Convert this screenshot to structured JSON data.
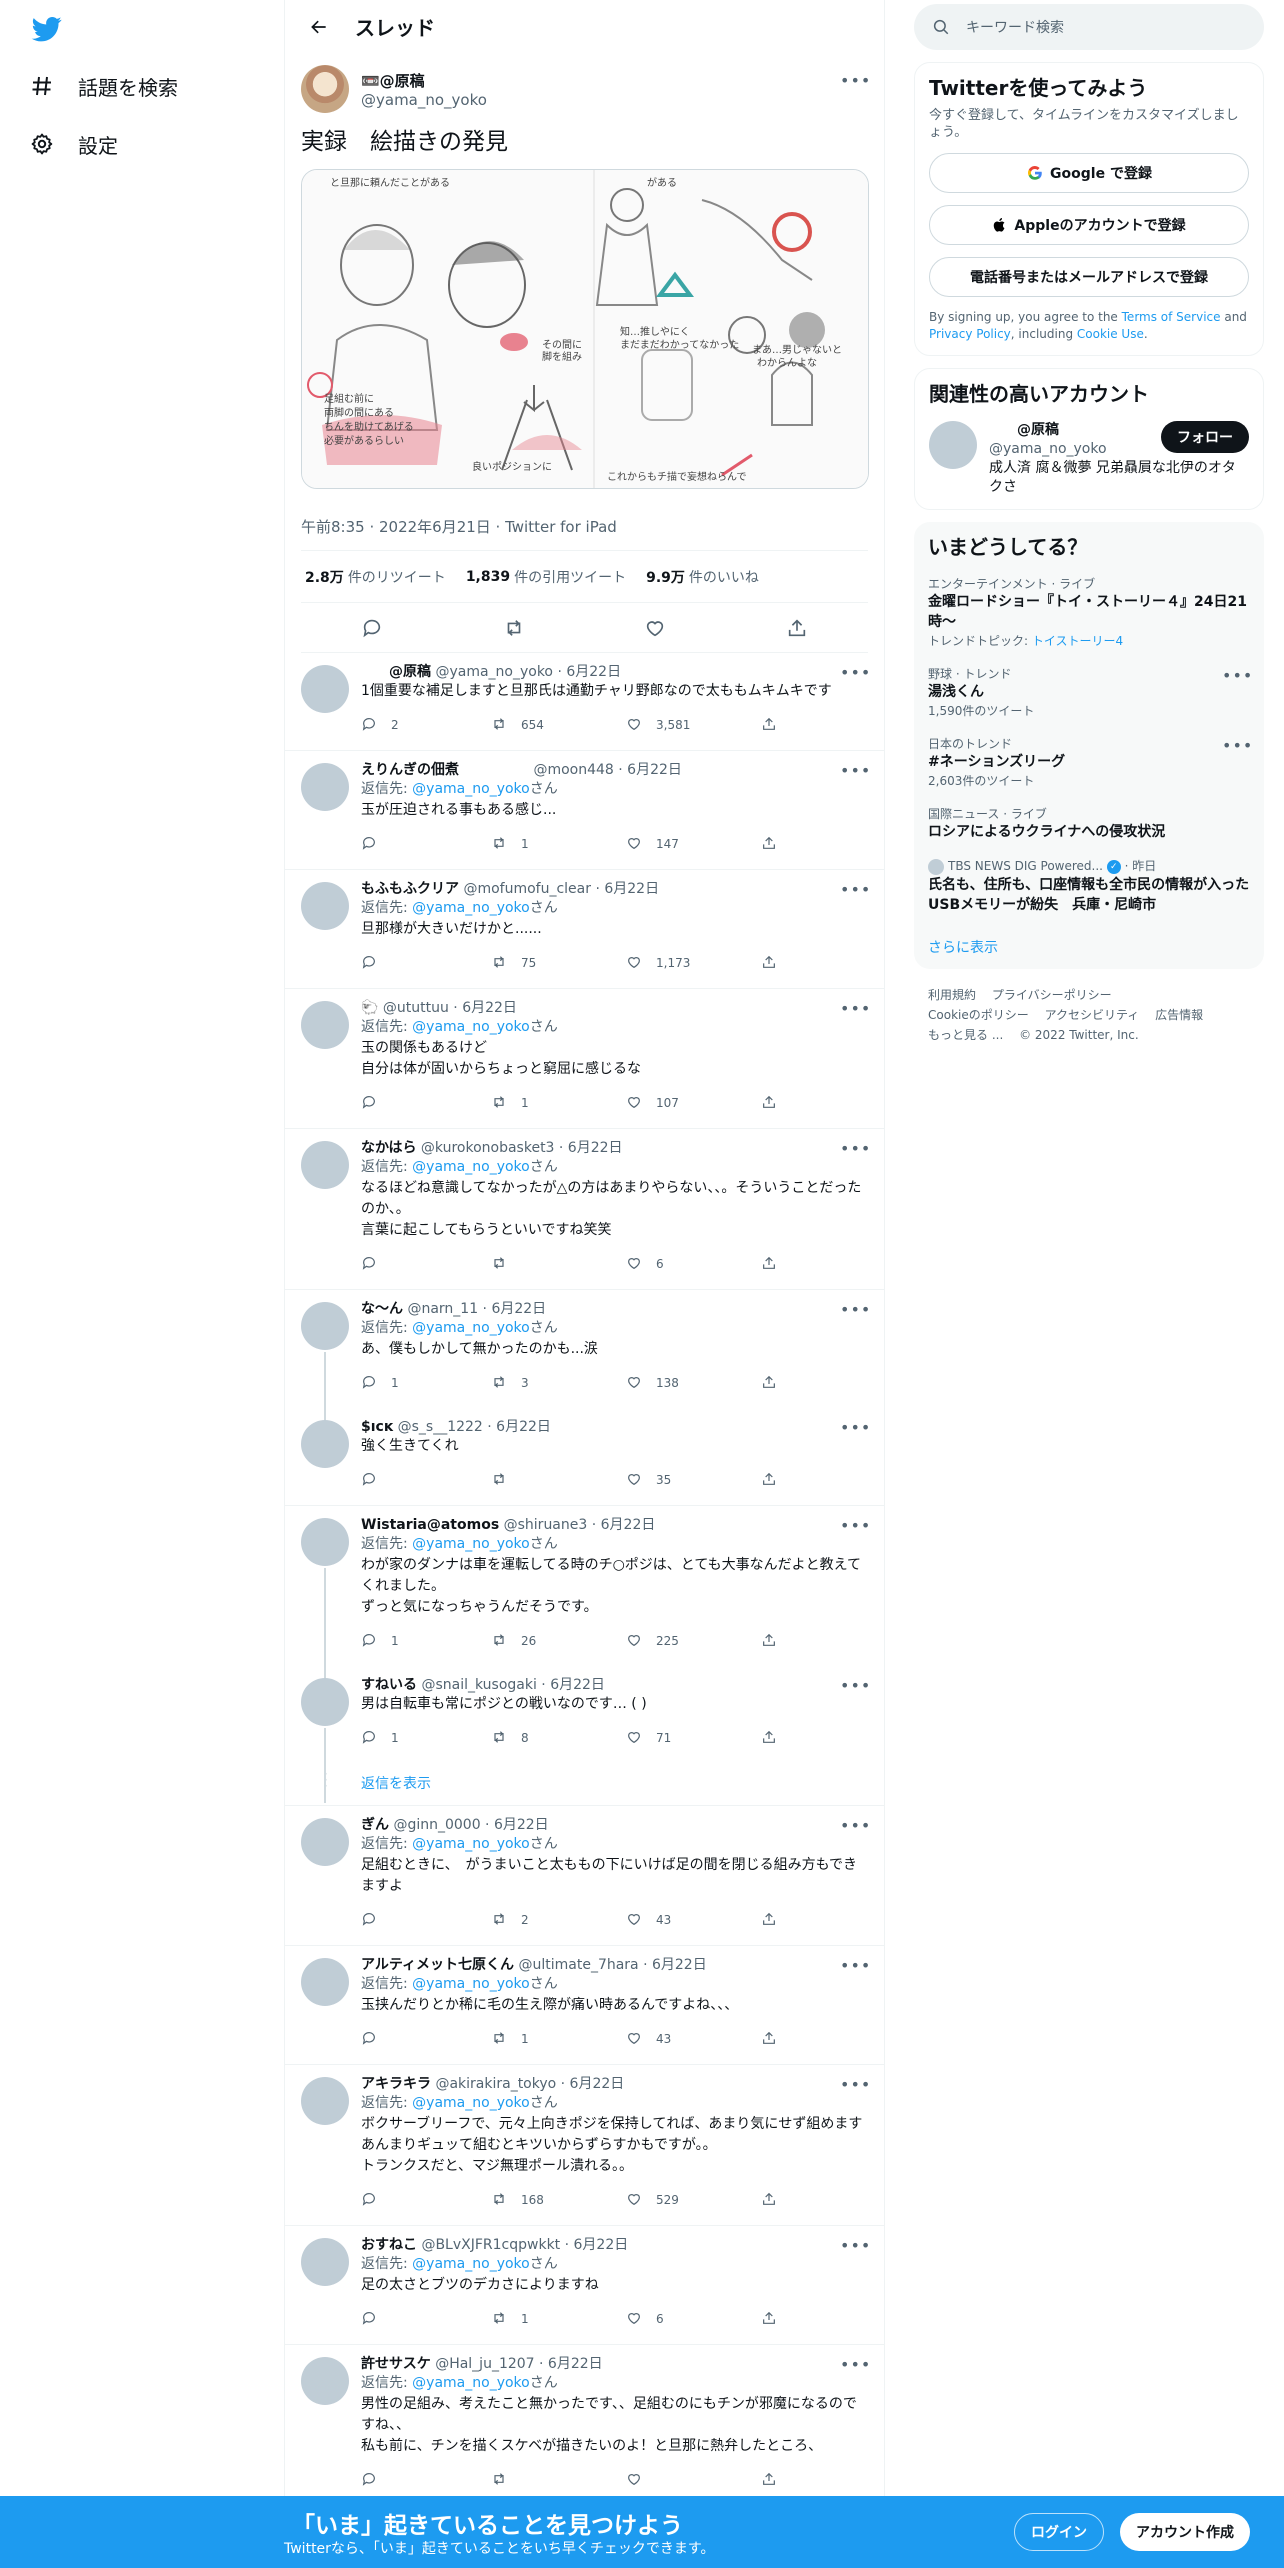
{
  "nav": {
    "explore_label": "話題を検索",
    "settings_label": "設定"
  },
  "header": {
    "title": "スレッド"
  },
  "main_tweet": {
    "display_name": "📼@原稿",
    "handle": "@yama_no_yoko",
    "text": "実録　絵描きの発見",
    "timestamp": "午前8:35 · 2022年6月21日 · Twitter for iPad",
    "stats": [
      {
        "num": "2.8万",
        "label": "件のリツイート"
      },
      {
        "num": "1,839",
        "label": "件の引用ツイート"
      },
      {
        "num": "9.9万",
        "label": "件のいいね"
      }
    ],
    "media_texts": {
      "t1": "と旦那に頼んだことがある",
      "t2": "がある",
      "t3": "足組む前に",
      "t4": "両脚の間にある",
      "t5": "ちんを助けてあげる",
      "t6": "必要があるらしい",
      "t7": "その間に",
      "t8": "脚を組み",
      "t9": "知…推しやにく",
      "t10": "まだまだわかってなかった",
      "t11": "まあ…男じゃないと",
      "t12": "わからんよな",
      "t13": "良いポジションに",
      "t14": "これからもチ描で妄想ねらんで"
    }
  },
  "reply_to_label": "返信先:",
  "reply_to_handle": "@yama_no_yoko",
  "reply_to_suffix": "さん",
  "replies": [
    {
      "name": "　　@原稿",
      "handle": "@yama_no_yoko · 6月22日",
      "has_reply_to": false,
      "text": "1個重要な補足しますと旦那氏は通勤チャリ野郎なので太ももムキムキです",
      "reply": "2",
      "rt": "654",
      "like": "3,581"
    },
    {
      "name": "えりんぎの佃煮",
      "handle": "　　　　　@moon448 · 6月22日",
      "has_reply_to": true,
      "text": "玉が圧迫される事もある感じ...",
      "reply": "",
      "rt": "1",
      "like": "147"
    },
    {
      "name": "もふもふクリア",
      "handle": "@mofumofu_clear · 6月22日",
      "has_reply_to": true,
      "text": "旦那様が大きいだけかと......",
      "reply": "",
      "rt": "75",
      "like": "1,173"
    },
    {
      "name": "🐑",
      "handle": "@ututtuu · 6月22日",
      "has_reply_to": true,
      "text": "玉の関係もあるけど\n自分は体が固いからちょっと窮屈に感じるな",
      "reply": "",
      "rt": "1",
      "like": "107"
    },
    {
      "name": "なかはら",
      "handle": "@kurokonobasket3 · 6月22日",
      "has_reply_to": true,
      "text": "なるほどね意識してなかったが△の方はあまりやらない、、。そういうことだったのか、。\n言葉に起こしてもらうといいですね笑笑",
      "reply": "",
      "rt": "",
      "like": "6"
    },
    {
      "name": "な～ん",
      "handle": "@narn_11 · 6月22日",
      "has_reply_to": true,
      "text": "あ、僕もしかして無かったのかも...涙",
      "reply": "1",
      "rt": "3",
      "like": "138"
    },
    {
      "name": "$ıcĸ",
      "handle": "@s_s__1222 · 6月22日",
      "has_reply_to": false,
      "text": "強く生きてくれ",
      "reply": "",
      "rt": "",
      "like": "35"
    },
    {
      "name": "Wistaria@atomos",
      "handle": "@shiruane3 · 6月22日",
      "has_reply_to": true,
      "text": "わが家のダンナは車を運転してる時のチ○ポジは、とても大事なんだよと教えてくれました。\nずっと気になっちゃうんだそうです。",
      "reply": "1",
      "rt": "26",
      "like": "225"
    },
    {
      "name": "すねいる",
      "handle": "@snail_kusogaki · 6月22日",
      "has_reply_to": false,
      "text": "男は自転車も常にポジとの戦いなのです… ( )",
      "reply": "1",
      "rt": "8",
      "like": "71"
    },
    {
      "name": "ぎん",
      "handle": "@ginn_0000 · 6月22日",
      "has_reply_to": true,
      "text": "足組むときに、　がうまいこと太ももの下にいけば足の間を閉じる組み方もできますよ",
      "reply": "",
      "rt": "2",
      "like": "43"
    },
    {
      "name": "アルティメット七原くん",
      "handle": "@ultimate_7hara · 6月22日",
      "has_reply_to": true,
      "text": "玉挟んだりとか稀に毛の生え際が痛い時あるんですよね、、、",
      "reply": "",
      "rt": "1",
      "like": "43"
    },
    {
      "name": "アキラキラ",
      "handle": "@akirakira_tokyo · 6月22日",
      "has_reply_to": true,
      "text": "ボクサーブリーフで、元々上向きポジを保持してれば、あまり気にせず組めます\nあんまりギュッて組むとキツいからずらすかもですが。。\nトランクスだと、マジ無理ポール潰れる。。",
      "reply": "",
      "rt": "168",
      "like": "529"
    },
    {
      "name": "おすねこ",
      "handle": "@BLvXJFR1cqpwkkt · 6月22日",
      "has_reply_to": true,
      "text": "足の太さとブツのデカさによりますね",
      "reply": "",
      "rt": "1",
      "like": "6"
    },
    {
      "name": "許せサスケ",
      "handle": "@Hal_ju_1207 · 6月22日",
      "has_reply_to": true,
      "text": "男性の足組み、考えたこと無かったです、、足組むのにもチンが邪魔になるのですね、、\n私も前に、チンを描くスケベが描きたいのよ！と旦那に熱弁したところ、",
      "reply": "",
      "rt": "",
      "like": ""
    }
  ],
  "show_replies_label": "返信を表示",
  "search": {
    "placeholder": "キーワード検索"
  },
  "signup_card": {
    "title": "Twitterを使ってみよう",
    "subtitle": "今すぐ登録して、タイムラインをカスタマイズしましょう。",
    "google": "Google で登録",
    "apple": "Appleのアカウントで登録",
    "phone": "電話番号またはメールアドレスで登録",
    "terms_pre": "By signing up, you agree to the ",
    "terms_tos": "Terms of Service",
    "terms_and": " and ",
    "terms_privacy": "Privacy Policy",
    "terms_incl": ", including ",
    "terms_cookie": "Cookie Use",
    "terms_end": "."
  },
  "relevant": {
    "title": "関連性の高いアカウント",
    "name": "　　@原稿",
    "handle": "@yama_no_yoko",
    "bio": "成人済 腐＆微夢 兄弟贔屓な北伊のオタクさ",
    "follow_label": "フォロー"
  },
  "trends": {
    "title": "いまどうしてる？",
    "items": [
      {
        "cat": "エンターテインメント · ライブ",
        "title": "金曜ロードショー『トイ・ストーリー４』24日21時〜",
        "extra_pre": "トレンドトピック: ",
        "extra_link": "トイストーリー4"
      },
      {
        "cat": "野球 · トレンド",
        "title": "湯浅くん",
        "extra_pre": "1,590件のツイート",
        "extra_link": ""
      },
      {
        "cat": "日本のトレンド",
        "title": "#ネーションズリーグ",
        "extra_pre": "2,603件のツイート",
        "extra_link": ""
      },
      {
        "cat": "国際ニュース · ライブ",
        "title": "ロシアによるウクライナへの侵攻状況",
        "extra_pre": "",
        "extra_link": ""
      }
    ],
    "news_source": "TBS NEWS DIG Powered...",
    "news_time": " · 昨日",
    "news_title": "氏名も、住所も、口座情報も全市民の情報が入ったUSBメモリーが紛失　兵庫・尼崎市",
    "show_more": "さらに表示"
  },
  "footer": {
    "links1": [
      "利用規約",
      "プライバシーポリシー"
    ],
    "links2": [
      "Cookieのポリシー",
      "アクセシビリティ",
      "広告情報"
    ],
    "more": "もっと見る ...",
    "copyright": "© 2022 Twitter, Inc."
  },
  "banner": {
    "headline": "「いま」起きていることを見つけよう",
    "sub": "Twitterなら、「いま」起きていることをいち早くチェックできます。",
    "login": "ログイン",
    "signup": "アカウント作成"
  },
  "colors": {
    "accent": "#1d9bf0",
    "text": "#0f1419",
    "muted": "#536471"
  }
}
